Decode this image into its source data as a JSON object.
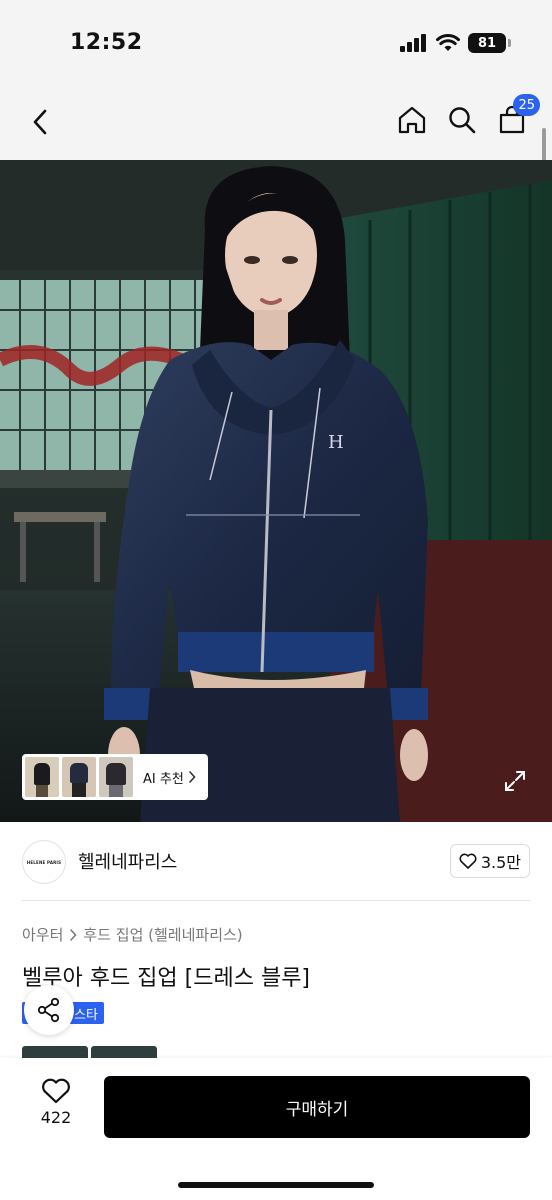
{
  "status_bar": {
    "time": "12:52",
    "battery": "81",
    "icons": [
      "signal-icon",
      "wifi-icon",
      "battery-icon"
    ]
  },
  "nav": {
    "back_icon": "chevron-left-icon",
    "home_icon": "home-icon",
    "search_icon": "search-icon",
    "cart_icon": "bag-icon",
    "cart_count": "25"
  },
  "hero": {
    "ai_recommend_label": "AI 추천",
    "expand_icon": "expand-icon"
  },
  "brand": {
    "logo_text": "HELENE PARIS",
    "name": "헬레네파리스",
    "like_count": "3.5만"
  },
  "breadcrumb": {
    "category": "아우터",
    "subcategory": "후드 집업 (헬레네파리스)"
  },
  "product": {
    "title": "벨루아 후드 집업 [드레스 블루]",
    "badge": "스타"
  },
  "bottom": {
    "wish_count": "422",
    "buy_label": "구매하기"
  },
  "colors": {
    "accent": "#2b62f0",
    "buy_button": "#000000"
  }
}
